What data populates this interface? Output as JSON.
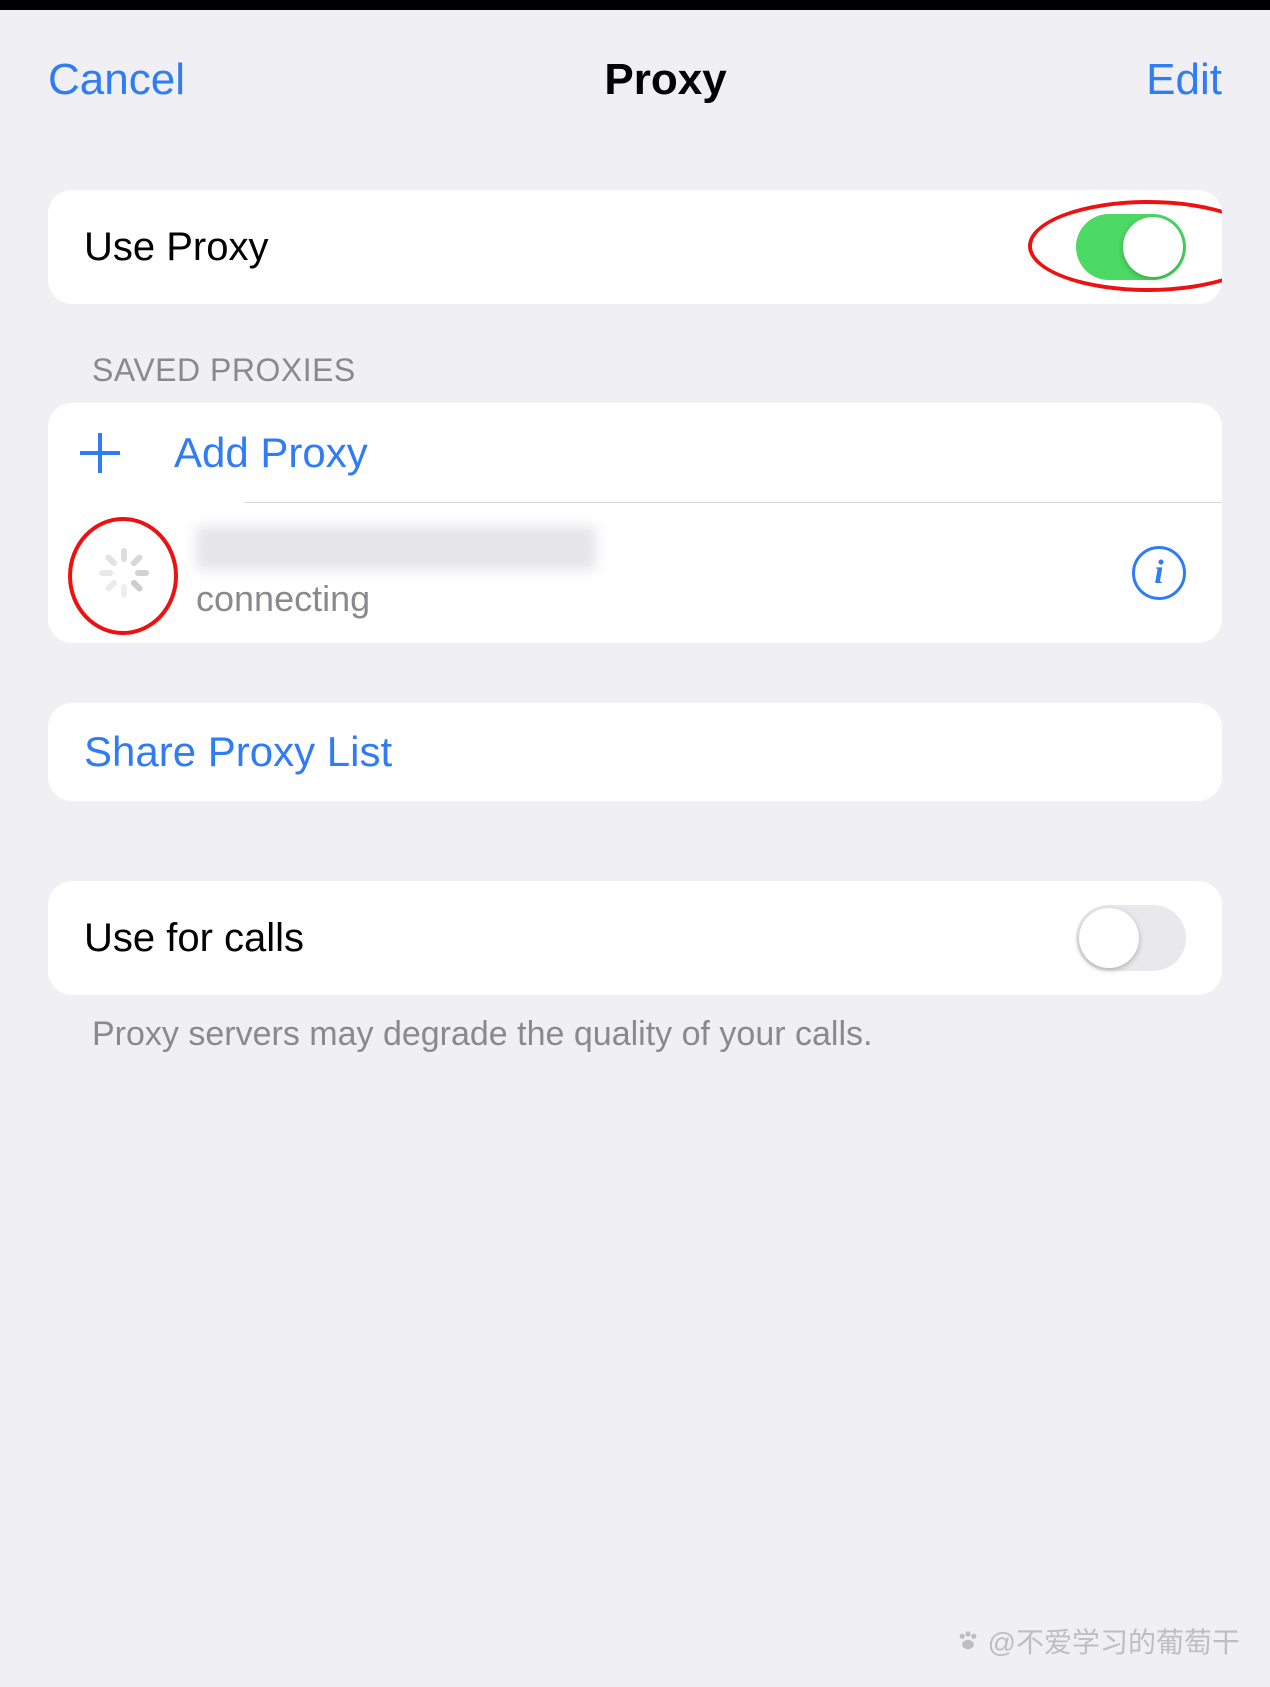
{
  "nav": {
    "cancel": "Cancel",
    "title": "Proxy",
    "edit": "Edit"
  },
  "useProxy": {
    "label": "Use Proxy",
    "enabled": true
  },
  "savedProxies": {
    "header": "SAVED PROXIES",
    "addLabel": "Add Proxy",
    "items": [
      {
        "status": "connecting"
      }
    ]
  },
  "share": {
    "label": "Share Proxy List"
  },
  "useForCalls": {
    "label": "Use for calls",
    "enabled": false,
    "footer": "Proxy servers may degrade the quality of your calls."
  },
  "watermark": "@不爱学习的葡萄干"
}
